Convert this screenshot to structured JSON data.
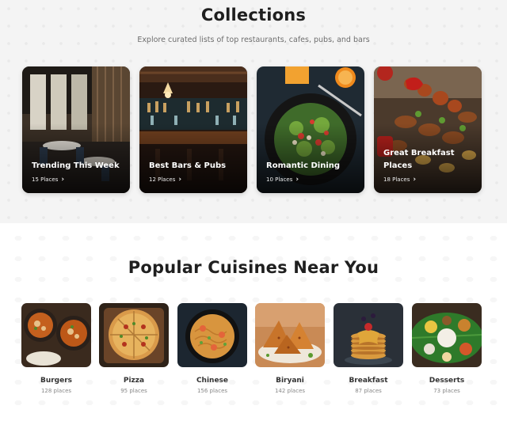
{
  "collections": {
    "title": "Collections",
    "subtitle": "Explore curated lists of top restaurants, cafes, pubs, and bars",
    "cards": [
      {
        "name": "Trending This Week",
        "count": "15 Places",
        "image": "restaurant-interior"
      },
      {
        "name": "Best Bars & Pubs",
        "count": "12 Places",
        "image": "bar-counter"
      },
      {
        "name": "Romantic Dining",
        "count": "10 Places",
        "image": "salad-plate"
      },
      {
        "name": "Great Breakfast Places",
        "count": "18 Places",
        "image": "grilled-platter"
      }
    ],
    "chevron": "›"
  },
  "cuisines": {
    "title": "Popular Cuisines Near You",
    "items": [
      {
        "name": "Burgers",
        "count": "128 places",
        "image": "curry-bowls"
      },
      {
        "name": "Pizza",
        "count": "95 places",
        "image": "pizza"
      },
      {
        "name": "Chinese",
        "count": "156 places",
        "image": "noodles-wok"
      },
      {
        "name": "Biryani",
        "count": "142 places",
        "image": "samosas"
      },
      {
        "name": "Breakfast",
        "count": "87 places",
        "image": "pancakes"
      },
      {
        "name": "Desserts",
        "count": "73 places",
        "image": "thali-leaf"
      }
    ]
  }
}
